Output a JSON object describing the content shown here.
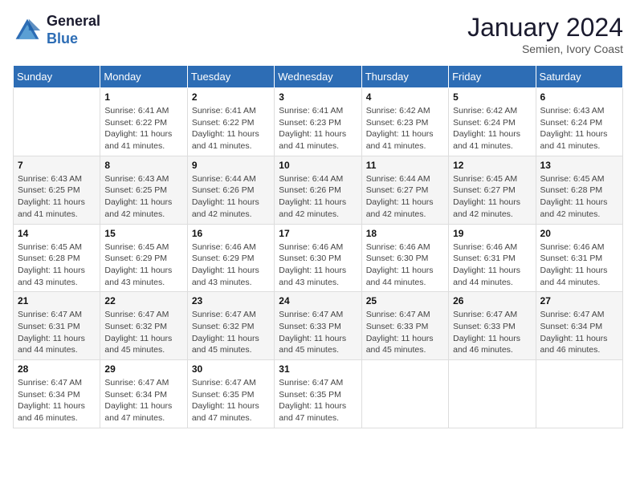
{
  "logo": {
    "line1": "General",
    "line2": "Blue"
  },
  "title": {
    "month_year": "January 2024",
    "location": "Semien, Ivory Coast"
  },
  "weekdays": [
    "Sunday",
    "Monday",
    "Tuesday",
    "Wednesday",
    "Thursday",
    "Friday",
    "Saturday"
  ],
  "weeks": [
    [
      {
        "day": "",
        "sunrise": "",
        "sunset": "",
        "daylight": ""
      },
      {
        "day": "1",
        "sunrise": "Sunrise: 6:41 AM",
        "sunset": "Sunset: 6:22 PM",
        "daylight": "Daylight: 11 hours and 41 minutes."
      },
      {
        "day": "2",
        "sunrise": "Sunrise: 6:41 AM",
        "sunset": "Sunset: 6:22 PM",
        "daylight": "Daylight: 11 hours and 41 minutes."
      },
      {
        "day": "3",
        "sunrise": "Sunrise: 6:41 AM",
        "sunset": "Sunset: 6:23 PM",
        "daylight": "Daylight: 11 hours and 41 minutes."
      },
      {
        "day": "4",
        "sunrise": "Sunrise: 6:42 AM",
        "sunset": "Sunset: 6:23 PM",
        "daylight": "Daylight: 11 hours and 41 minutes."
      },
      {
        "day": "5",
        "sunrise": "Sunrise: 6:42 AM",
        "sunset": "Sunset: 6:24 PM",
        "daylight": "Daylight: 11 hours and 41 minutes."
      },
      {
        "day": "6",
        "sunrise": "Sunrise: 6:43 AM",
        "sunset": "Sunset: 6:24 PM",
        "daylight": "Daylight: 11 hours and 41 minutes."
      }
    ],
    [
      {
        "day": "7",
        "sunrise": "Sunrise: 6:43 AM",
        "sunset": "Sunset: 6:25 PM",
        "daylight": "Daylight: 11 hours and 41 minutes."
      },
      {
        "day": "8",
        "sunrise": "Sunrise: 6:43 AM",
        "sunset": "Sunset: 6:25 PM",
        "daylight": "Daylight: 11 hours and 42 minutes."
      },
      {
        "day": "9",
        "sunrise": "Sunrise: 6:44 AM",
        "sunset": "Sunset: 6:26 PM",
        "daylight": "Daylight: 11 hours and 42 minutes."
      },
      {
        "day": "10",
        "sunrise": "Sunrise: 6:44 AM",
        "sunset": "Sunset: 6:26 PM",
        "daylight": "Daylight: 11 hours and 42 minutes."
      },
      {
        "day": "11",
        "sunrise": "Sunrise: 6:44 AM",
        "sunset": "Sunset: 6:27 PM",
        "daylight": "Daylight: 11 hours and 42 minutes."
      },
      {
        "day": "12",
        "sunrise": "Sunrise: 6:45 AM",
        "sunset": "Sunset: 6:27 PM",
        "daylight": "Daylight: 11 hours and 42 minutes."
      },
      {
        "day": "13",
        "sunrise": "Sunrise: 6:45 AM",
        "sunset": "Sunset: 6:28 PM",
        "daylight": "Daylight: 11 hours and 42 minutes."
      }
    ],
    [
      {
        "day": "14",
        "sunrise": "Sunrise: 6:45 AM",
        "sunset": "Sunset: 6:28 PM",
        "daylight": "Daylight: 11 hours and 43 minutes."
      },
      {
        "day": "15",
        "sunrise": "Sunrise: 6:45 AM",
        "sunset": "Sunset: 6:29 PM",
        "daylight": "Daylight: 11 hours and 43 minutes."
      },
      {
        "day": "16",
        "sunrise": "Sunrise: 6:46 AM",
        "sunset": "Sunset: 6:29 PM",
        "daylight": "Daylight: 11 hours and 43 minutes."
      },
      {
        "day": "17",
        "sunrise": "Sunrise: 6:46 AM",
        "sunset": "Sunset: 6:30 PM",
        "daylight": "Daylight: 11 hours and 43 minutes."
      },
      {
        "day": "18",
        "sunrise": "Sunrise: 6:46 AM",
        "sunset": "Sunset: 6:30 PM",
        "daylight": "Daylight: 11 hours and 44 minutes."
      },
      {
        "day": "19",
        "sunrise": "Sunrise: 6:46 AM",
        "sunset": "Sunset: 6:31 PM",
        "daylight": "Daylight: 11 hours and 44 minutes."
      },
      {
        "day": "20",
        "sunrise": "Sunrise: 6:46 AM",
        "sunset": "Sunset: 6:31 PM",
        "daylight": "Daylight: 11 hours and 44 minutes."
      }
    ],
    [
      {
        "day": "21",
        "sunrise": "Sunrise: 6:47 AM",
        "sunset": "Sunset: 6:31 PM",
        "daylight": "Daylight: 11 hours and 44 minutes."
      },
      {
        "day": "22",
        "sunrise": "Sunrise: 6:47 AM",
        "sunset": "Sunset: 6:32 PM",
        "daylight": "Daylight: 11 hours and 45 minutes."
      },
      {
        "day": "23",
        "sunrise": "Sunrise: 6:47 AM",
        "sunset": "Sunset: 6:32 PM",
        "daylight": "Daylight: 11 hours and 45 minutes."
      },
      {
        "day": "24",
        "sunrise": "Sunrise: 6:47 AM",
        "sunset": "Sunset: 6:33 PM",
        "daylight": "Daylight: 11 hours and 45 minutes."
      },
      {
        "day": "25",
        "sunrise": "Sunrise: 6:47 AM",
        "sunset": "Sunset: 6:33 PM",
        "daylight": "Daylight: 11 hours and 45 minutes."
      },
      {
        "day": "26",
        "sunrise": "Sunrise: 6:47 AM",
        "sunset": "Sunset: 6:33 PM",
        "daylight": "Daylight: 11 hours and 46 minutes."
      },
      {
        "day": "27",
        "sunrise": "Sunrise: 6:47 AM",
        "sunset": "Sunset: 6:34 PM",
        "daylight": "Daylight: 11 hours and 46 minutes."
      }
    ],
    [
      {
        "day": "28",
        "sunrise": "Sunrise: 6:47 AM",
        "sunset": "Sunset: 6:34 PM",
        "daylight": "Daylight: 11 hours and 46 minutes."
      },
      {
        "day": "29",
        "sunrise": "Sunrise: 6:47 AM",
        "sunset": "Sunset: 6:34 PM",
        "daylight": "Daylight: 11 hours and 47 minutes."
      },
      {
        "day": "30",
        "sunrise": "Sunrise: 6:47 AM",
        "sunset": "Sunset: 6:35 PM",
        "daylight": "Daylight: 11 hours and 47 minutes."
      },
      {
        "day": "31",
        "sunrise": "Sunrise: 6:47 AM",
        "sunset": "Sunset: 6:35 PM",
        "daylight": "Daylight: 11 hours and 47 minutes."
      },
      {
        "day": "",
        "sunrise": "",
        "sunset": "",
        "daylight": ""
      },
      {
        "day": "",
        "sunrise": "",
        "sunset": "",
        "daylight": ""
      },
      {
        "day": "",
        "sunrise": "",
        "sunset": "",
        "daylight": ""
      }
    ]
  ]
}
